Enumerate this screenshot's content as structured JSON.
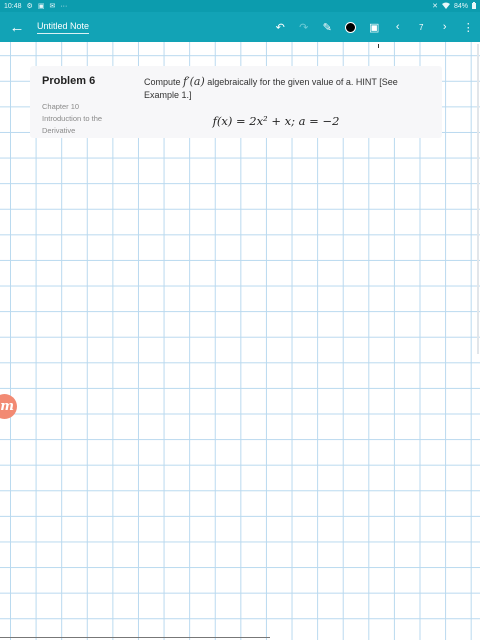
{
  "status_bar": {
    "time": "10:48",
    "left_icons": [
      "settings-icon",
      "image-icon",
      "mail-icon"
    ],
    "more": "···",
    "right_icons": [
      "mute-icon",
      "wifi-icon"
    ],
    "battery": "84%"
  },
  "toolbar": {
    "back_icon": "←",
    "note_title": "Untitled Note",
    "undo_icon": "↶",
    "redo_icon": "↷",
    "pen_icon": "✎",
    "image_icon": "▣",
    "prev_icon": "‹",
    "page_number": "7",
    "next_icon": "›",
    "menu_icon": "⋮",
    "accent_color": "#12a3b6",
    "ink_color": "#000000"
  },
  "problem": {
    "title": "Problem 6",
    "chapter": "Chapter 10",
    "chapter_title": "Introduction to the Derivative",
    "text_before": "Compute",
    "math_term": "f′(a)",
    "text_after": "algebraically for the given value of a. HINT [See Example 1.]",
    "formula": "f(x) = 2x² + x; a = −2"
  },
  "side_badge": {
    "letter": "m",
    "color": "#f28a73"
  }
}
